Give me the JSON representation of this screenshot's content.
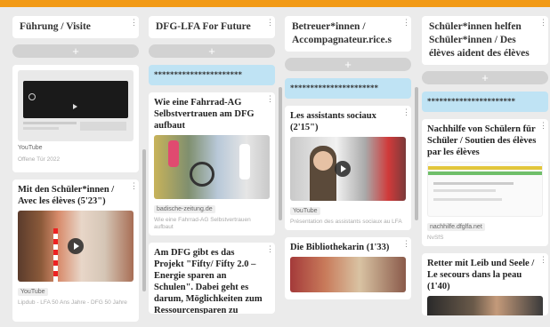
{
  "columns": [
    {
      "title": "Führung / Visite",
      "add_label": "+",
      "cards": [
        {
          "source": "YouTube",
          "caption": "Offene Tür 2022"
        },
        {
          "title": "Mit den Schüler*innen / Avec les élèves (5'23\")",
          "source": "YouTube",
          "caption": "Lipdub - LFA 50 Ans Jahre - DFG 50 Jahre"
        }
      ]
    },
    {
      "title": "DFG-LFA For Future",
      "add_label": "+",
      "cards": [
        {
          "stars": "**********************"
        },
        {
          "title": "Wie eine Fahrrad-AG Selbstvertrauen am DFG aufbaut",
          "source": "badische-zeitung.de",
          "caption": "Wie eine Fahrrad-AG Selbstvertrauen aufbaut"
        },
        {
          "title": "Am DFG gibt es das Projekt \"Fifty/ Fifty 2.0 – Energie sparen an Schulen\". Dabei geht es darum, Möglichkeiten zum Ressourcensparen zu"
        }
      ]
    },
    {
      "title": "Betreuer*innen / Accompagnateur.rice.s",
      "add_label": "+",
      "cards": [
        {
          "stars": "**********************"
        },
        {
          "title": "Les assistants sociaux (2'15\")",
          "source": "YouTube",
          "caption": "Présentation des assistants sociaux au LFA"
        },
        {
          "title": "Die Bibliothekarin (1'33)"
        }
      ]
    },
    {
      "title": "Schüler*innen helfen Schüler*innen / Des élèves aident des élèves",
      "add_label": "+",
      "cards": [
        {
          "stars": "**********************"
        },
        {
          "title": "Nachhilfe von Schülern für Schüler / Soutien des élèves par les élèves",
          "source": "nachhilfe.dfglfa.net",
          "caption": "NvSfS"
        },
        {
          "title": "Retter mit Leib und Seele / Le secours dans la peau (1'40)"
        }
      ]
    }
  ],
  "icons": {
    "menu": "kebab-menu-icon",
    "play": "play-icon"
  }
}
